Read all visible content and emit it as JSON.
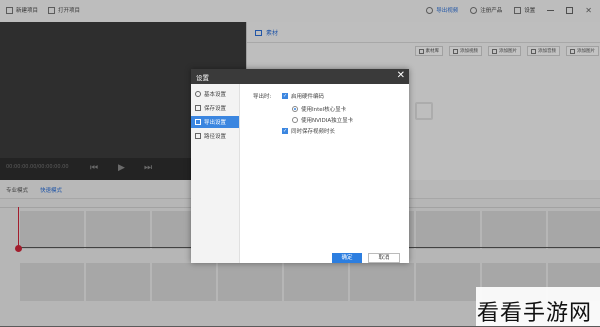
{
  "topbar": {
    "left": [
      {
        "icon": "new-project-icon",
        "label": "新建项目"
      },
      {
        "icon": "open-project-icon",
        "label": "打开项目"
      }
    ],
    "right": [
      {
        "icon": "export-video-icon",
        "label": "导出视频"
      },
      {
        "icon": "account-icon",
        "label": "注册产品"
      },
      {
        "icon": "settings-icon",
        "label": "设置"
      }
    ]
  },
  "preview": {
    "time": "00:00:00.00/00:00:00.00"
  },
  "material": {
    "tab": "素材",
    "actions": [
      "素材库",
      "添加视频",
      "添加图片",
      "添加音频",
      "添加图片"
    ]
  },
  "modes": {
    "pro": "专业模式",
    "quick": "快速模式"
  },
  "dialog": {
    "title": "设置",
    "nav": [
      {
        "icon": "gear-icon",
        "label": "基本设置"
      },
      {
        "icon": "save-icon",
        "label": "保存设置"
      },
      {
        "icon": "export-icon",
        "label": "导出设置",
        "active": true
      },
      {
        "icon": "folder-icon",
        "label": "路径设置"
      }
    ],
    "export_label": "导出时:",
    "hw_encode": "启用硬件编码",
    "radio_intel": "使用Intel核心显卡",
    "radio_nvidia": "使用NVIDIA独立显卡",
    "save_timeline": "同时保存视频时长",
    "ok": "确定",
    "cancel": "取消"
  },
  "watermark": "看看手游网"
}
